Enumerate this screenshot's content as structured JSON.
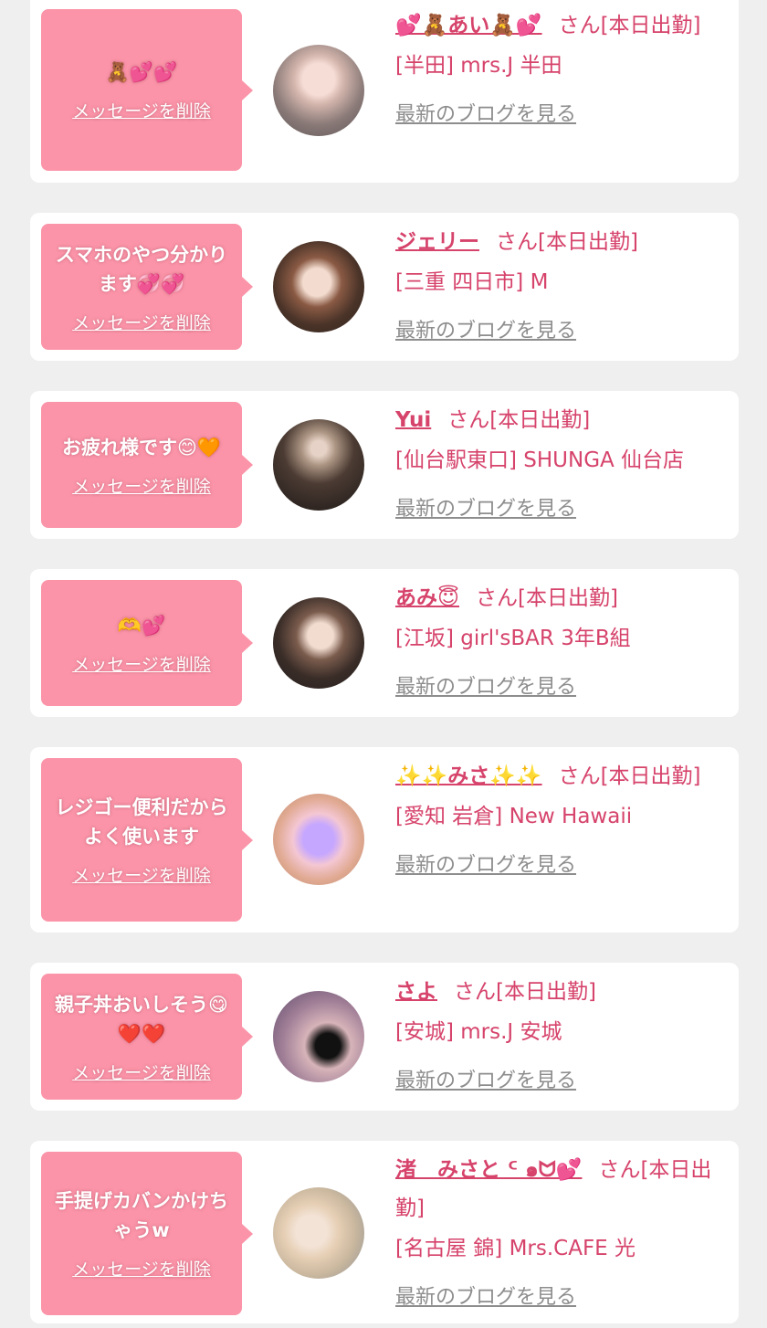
{
  "delete_label": "メッセージを削除",
  "blog_label": "最新のブログを見る",
  "cards": [
    {
      "message": "🧸💕💕",
      "name": "💕🧸あい🧸💕",
      "status": "さん[本日出勤]",
      "shop": "[半田] mrs.J 半田"
    },
    {
      "message": "スマホのやつ分かります💞💞",
      "name": "ジェリー",
      "status": "さん[本日出勤]",
      "shop": "[三重 四日市] M"
    },
    {
      "message": "お疲れ様です😊🧡",
      "name": "Yui",
      "status": "さん[本日出勤]",
      "shop": "[仙台駅東口] SHUNGA 仙台店"
    },
    {
      "message": "🫶💕",
      "name": "あみ😇",
      "status": "さん[本日出勤]",
      "shop": "[江坂] girl'sBAR 3年B組"
    },
    {
      "message": "レジゴー便利だからよく使います",
      "name": "✨✨みさ✨✨",
      "status": "さん[本日出勤]",
      "shop": "[愛知 岩倉] New Hawaii"
    },
    {
      "message": "親子丼おいしそう😋❤️❤️",
      "name": "さよ",
      "status": "さん[本日出勤]",
      "shop": "[安城] mrs.J 安城"
    },
    {
      "message": "手提げカバンかけちゃうw",
      "name": "渚　みさと ᑦ ๑ᗢ💕",
      "status": "さん[本日出勤]",
      "shop": "[名古屋 錦] Mrs.CAFE 光"
    }
  ],
  "colors": {
    "background": "#efefef",
    "bubble": "#fb94a8",
    "name_pink": "#d6436b",
    "link_gray": "#8d8d8d"
  }
}
